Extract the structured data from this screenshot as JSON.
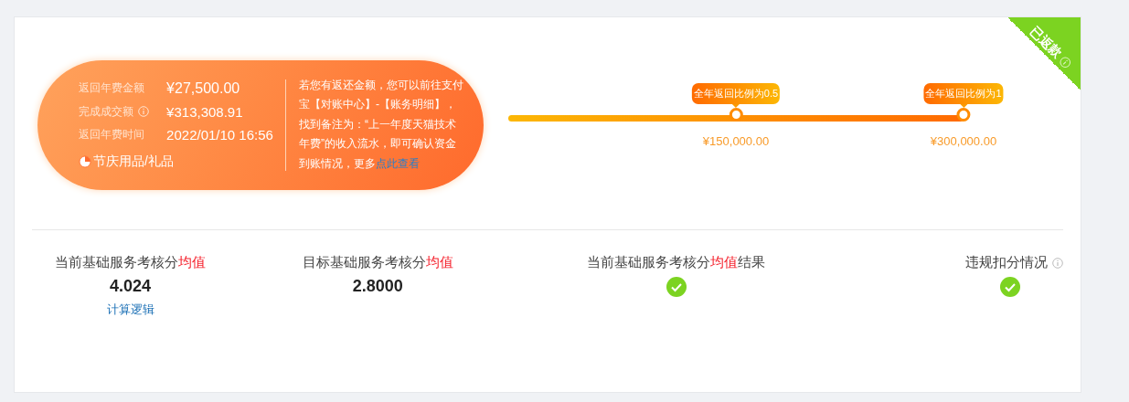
{
  "summary": {
    "rows": [
      {
        "label": "返回年费金额",
        "value": "¥27,500.00",
        "info": false
      },
      {
        "label": "完成成交额",
        "value": "¥313,308.91",
        "info": true
      },
      {
        "label": "返回年费时间",
        "value": "2022/01/10 16:56",
        "info": false
      }
    ],
    "category": "节庆用品/礼品",
    "note": "若您有返还金额，您可以前往支付宝【对账中心】-【账务明细】，找到备注为：“上一年度天猫技术年费”的收入流水，即可确认资金到账情况，更多",
    "link": "点此查看"
  },
  "badge": {
    "text": "已返款"
  },
  "progress": {
    "milestones": [
      {
        "tip": "全年返回比例为0.5",
        "amount": "¥150,000.00",
        "reached": true
      },
      {
        "tip": "全年返回比例为1",
        "amount": "¥300,000.00",
        "reached": true
      }
    ]
  },
  "metrics": [
    {
      "kind": "value",
      "title": {
        "text": "当前基础服务考核分",
        "highlight": "均值"
      },
      "value": "4.024",
      "link": "计算逻辑",
      "info": false
    },
    {
      "kind": "value",
      "title": {
        "text": "目标基础服务考核分",
        "highlight": "均值"
      },
      "value": "2.8000",
      "info": false
    },
    {
      "kind": "check",
      "title": {
        "text": "当前基础服务考核分",
        "highlight": "均值",
        "suffix": "结果"
      },
      "passed": true,
      "info": false
    },
    {
      "kind": "check",
      "title": {
        "text": "违规扣分情况"
      },
      "passed": true,
      "info": true
    }
  ]
}
